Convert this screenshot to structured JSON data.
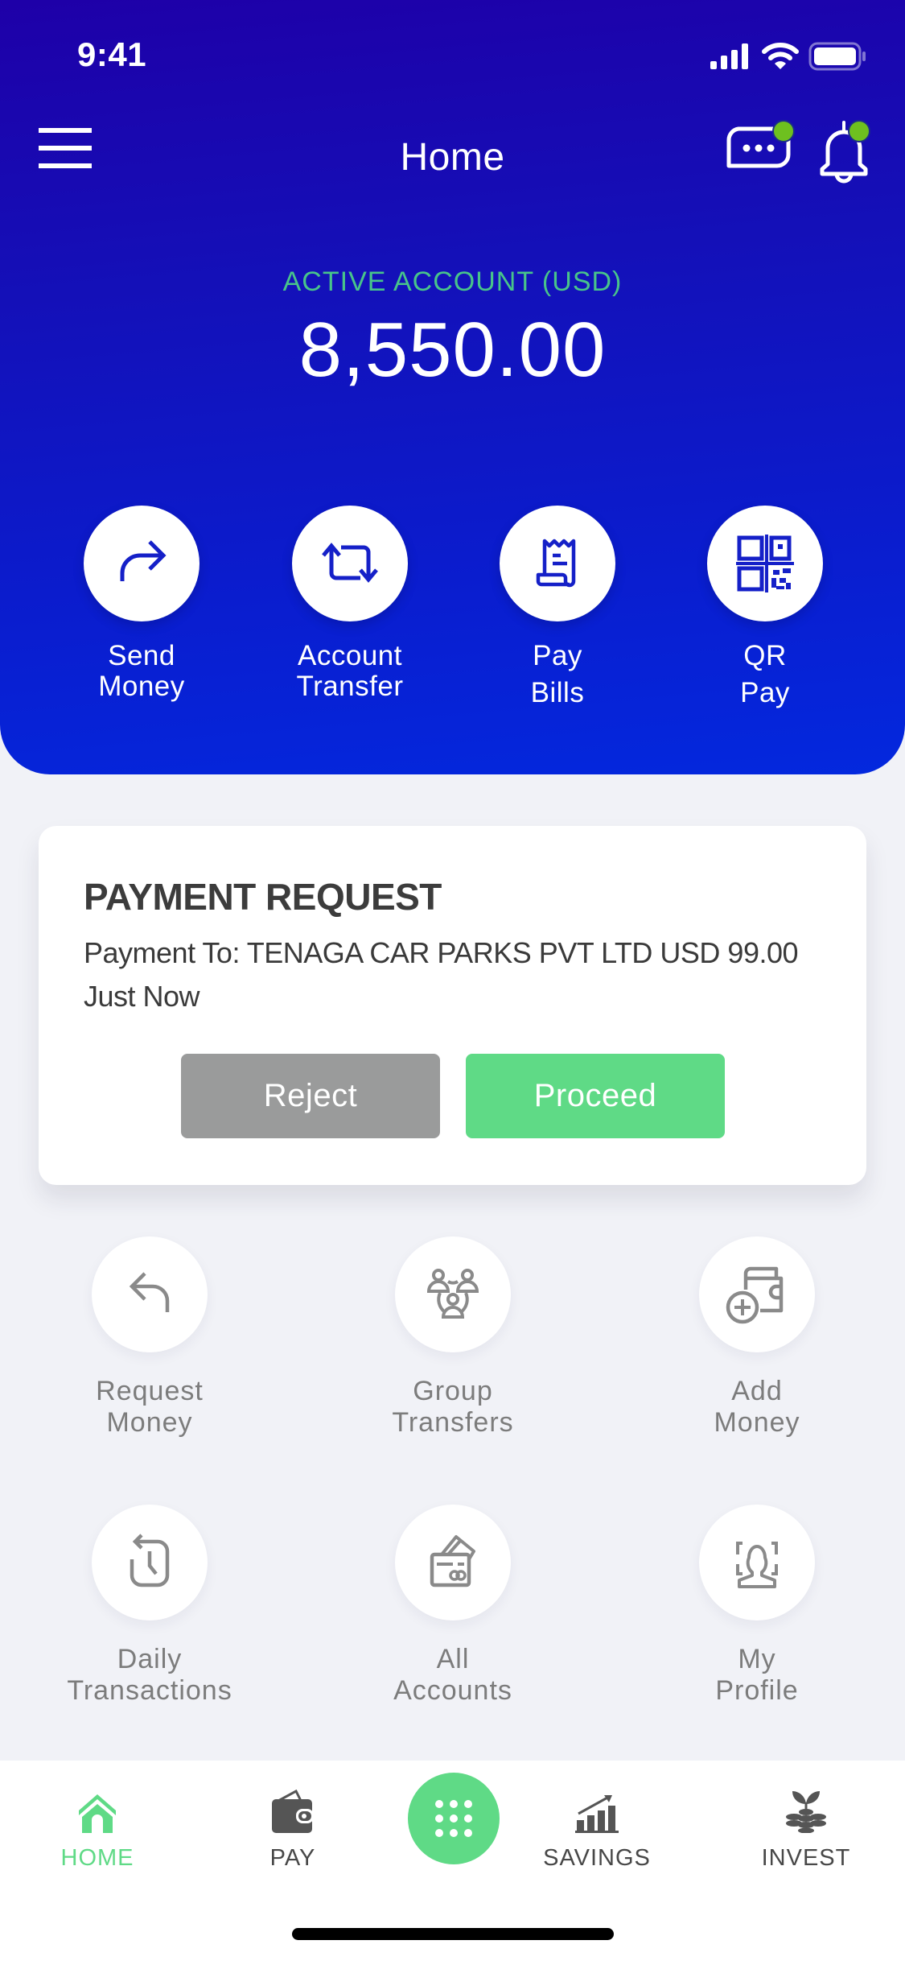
{
  "status_bar": {
    "time": "9:41",
    "icons": [
      "cellular-signal-icon",
      "wifi-icon",
      "battery-icon"
    ]
  },
  "header": {
    "title": "Home",
    "menu_icon": "hamburger-menu-icon",
    "chat_icon": "chat-bubble-icon",
    "notification_icon": "bell-icon",
    "chat_has_badge": true,
    "notification_has_badge": true
  },
  "account": {
    "label": "ACTIVE  ACCOUNT (USD)",
    "balance": "8,550.00"
  },
  "quick_actions": [
    {
      "icon": "send-arrow-icon",
      "line1": "Send",
      "line2": "Money"
    },
    {
      "icon": "transfer-arrows-icon",
      "line1": "Account",
      "line2": "Transfer"
    },
    {
      "icon": "receipt-icon",
      "line1": "Pay",
      "line2": "Bills"
    },
    {
      "icon": "qr-code-icon",
      "line1": "QR",
      "line2": "Pay"
    }
  ],
  "payment_request": {
    "title": "PAYMENT REQUEST",
    "details": "Payment To: TENAGA CAR PARKS PVT LTD  USD 99.00",
    "time": "Just Now",
    "reject_label": "Reject",
    "proceed_label": "Proceed"
  },
  "services": [
    {
      "icon": "reply-arrow-icon",
      "line1": "Request",
      "line2": "Money"
    },
    {
      "icon": "group-users-icon",
      "line1": "Group",
      "line2": "Transfers"
    },
    {
      "icon": "wallet-add-icon",
      "line1": "Add",
      "line2": "Money"
    },
    {
      "icon": "history-clock-icon",
      "line1": "Daily",
      "line2": "Transactions"
    },
    {
      "icon": "cards-icon",
      "line1": "All",
      "line2": "Accounts"
    },
    {
      "icon": "profile-scan-icon",
      "line1": "My",
      "line2": "Profile"
    }
  ],
  "tab_bar": {
    "tabs": [
      {
        "label": "HOME",
        "icon": "home-icon",
        "active": true
      },
      {
        "label": "PAY",
        "icon": "wallet-icon",
        "active": false
      },
      {
        "label": "SAVINGS",
        "icon": "growth-chart-icon",
        "active": false
      },
      {
        "label": "INVEST",
        "icon": "plant-coins-icon",
        "active": false
      }
    ],
    "center_button_icon": "grid-dots-icon"
  },
  "colors": {
    "header_gradient_top": "#1E00A8",
    "header_gradient_bottom": "#0328DE",
    "accent_green": "#5FDA86",
    "label_green": "#48C48A",
    "reject_gray": "#9A9B9B",
    "badge_green": "#6EC01F",
    "icon_blue": "#1520C8",
    "background": "#F1F2F7"
  }
}
